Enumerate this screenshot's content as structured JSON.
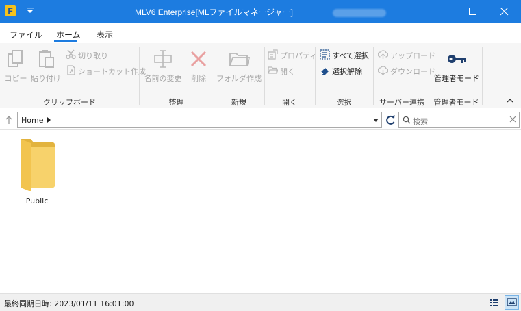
{
  "window": {
    "title": "MLV6 Enterprise[MLファイルマネージャー]",
    "logo_letter": "F",
    "colors": {
      "titlebar": "#1d7ce0",
      "accent": "#1d7ce0",
      "folder": "#f7d26b"
    }
  },
  "tabs": [
    {
      "label": "ファイル"
    },
    {
      "label": "ホーム",
      "selected": true
    },
    {
      "label": "表示"
    }
  ],
  "ribbon": {
    "clipboard": {
      "label": "クリップボード",
      "copy": "コピー",
      "paste": "貼り付け",
      "cut": "切り取り",
      "shortcut": "ショートカット作成"
    },
    "organize": {
      "label": "整理",
      "rename": "名前の変更",
      "delete": "削除"
    },
    "new": {
      "label": "新規",
      "new_folder": "フォルダ作成"
    },
    "open": {
      "label": "開く",
      "properties": "プロパティ",
      "open": "開く"
    },
    "select": {
      "label": "選択",
      "select_all": "すべて選択",
      "deselect": "選択解除"
    },
    "server": {
      "label": "サーバー連携",
      "upload": "アップロード",
      "download": "ダウンロード"
    },
    "admin": {
      "label": "管理者モード",
      "admin_mode": "管理者モード"
    }
  },
  "address": {
    "path": "Home",
    "search_placeholder": "検索"
  },
  "items": [
    {
      "name": "Public",
      "type": "folder"
    }
  ],
  "status": {
    "text": "最終同期日時: 2023/01/11 16:01:00"
  }
}
